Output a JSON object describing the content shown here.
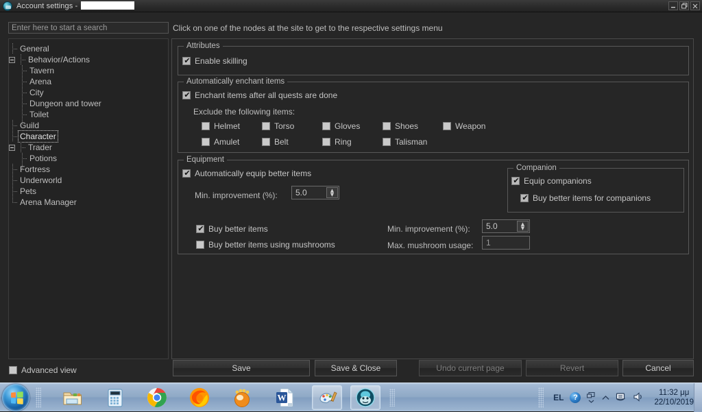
{
  "window": {
    "title": "Account settings -",
    "icon": "app-avatar-icon",
    "redacted_account": true,
    "controls": {
      "minimize": "minimize-icon",
      "restore": "restore-icon",
      "close": "close-icon"
    }
  },
  "search": {
    "placeholder": "Enter here to start a search",
    "value": ""
  },
  "hint": "Click on one of the nodes at the site to get to the respective settings menu",
  "tree": {
    "items": [
      {
        "label": "General",
        "level": 1,
        "expander": false,
        "selected": false
      },
      {
        "label": "Behavior/Actions",
        "level": 1,
        "expander": true,
        "selected": false
      },
      {
        "label": "Tavern",
        "level": 2,
        "expander": false,
        "selected": false
      },
      {
        "label": "Arena",
        "level": 2,
        "expander": false,
        "selected": false
      },
      {
        "label": "City",
        "level": 2,
        "expander": false,
        "selected": false
      },
      {
        "label": "Dungeon and tower",
        "level": 2,
        "expander": false,
        "selected": false
      },
      {
        "label": "Toilet",
        "level": 2,
        "expander": false,
        "selected": false,
        "last": true
      },
      {
        "label": "Guild",
        "level": 1,
        "expander": false,
        "selected": false
      },
      {
        "label": "Character",
        "level": 1,
        "expander": false,
        "selected": true
      },
      {
        "label": "Trader",
        "level": 1,
        "expander": true,
        "selected": false
      },
      {
        "label": "Potions",
        "level": 2,
        "expander": false,
        "selected": false,
        "last": true
      },
      {
        "label": "Fortress",
        "level": 1,
        "expander": false,
        "selected": false
      },
      {
        "label": "Underworld",
        "level": 1,
        "expander": false,
        "selected": false
      },
      {
        "label": "Pets",
        "level": 1,
        "expander": false,
        "selected": false
      },
      {
        "label": "Arena Manager",
        "level": 1,
        "expander": false,
        "selected": false,
        "last": true
      }
    ]
  },
  "attributes": {
    "title": "Attributes",
    "enable_skilling": {
      "label": "Enable skilling",
      "checked": true
    }
  },
  "enchant": {
    "title": "Automatically enchant items",
    "enchant_after_quests": {
      "label": "Enchant items after all quests are done",
      "checked": true
    },
    "exclude_label": "Exclude the following items:",
    "exclude_items_row1": [
      {
        "label": "Helmet",
        "checked": false
      },
      {
        "label": "Torso",
        "checked": false
      },
      {
        "label": "Gloves",
        "checked": false
      },
      {
        "label": "Shoes",
        "checked": false
      },
      {
        "label": "Weapon",
        "checked": false
      }
    ],
    "exclude_items_row2": [
      {
        "label": "Amulet",
        "checked": false
      },
      {
        "label": "Belt",
        "checked": false
      },
      {
        "label": "Ring",
        "checked": false
      },
      {
        "label": "Talisman",
        "checked": false
      }
    ]
  },
  "equipment": {
    "title": "Equipment",
    "auto_equip": {
      "label": "Automatically equip better items",
      "checked": true
    },
    "min_improvement_label": "Min. improvement (%):",
    "min_improvement_value": "5.0",
    "buy_better_items": {
      "label": "Buy better items",
      "checked": true
    },
    "buy_with_mushrooms": {
      "label": "Buy better items using mushrooms",
      "checked": false
    },
    "buy_min_improvement_label": "Min. improvement (%):",
    "buy_min_improvement_value": "5.0",
    "max_mushroom_label": "Max. mushroom usage:",
    "max_mushroom_value": "1"
  },
  "companion": {
    "title": "Companion",
    "equip_companions": {
      "label": "Equip companions",
      "checked": true
    },
    "buy_better_for_companions": {
      "label": "Buy better items for companions",
      "checked": true
    }
  },
  "footer": {
    "advanced_view": {
      "label": "Advanced view",
      "checked": false
    },
    "buttons": [
      {
        "label": "Save",
        "disabled": false
      },
      {
        "label": "Save & Close",
        "disabled": false
      },
      {
        "label": "Undo current page",
        "disabled": true
      },
      {
        "label": "Revert",
        "disabled": true
      },
      {
        "label": "Cancel",
        "disabled": false
      }
    ]
  },
  "taskbar": {
    "start": "windows-start-orb",
    "apps": [
      {
        "name": "file-explorer-icon",
        "running": false
      },
      {
        "name": "calculator-icon",
        "running": false
      },
      {
        "name": "google-chrome-icon",
        "running": false
      },
      {
        "name": "mozilla-firefox-icon",
        "running": false
      },
      {
        "name": "orange-app-icon",
        "running": false
      },
      {
        "name": "microsoft-word-icon",
        "running": false
      },
      {
        "name": "paint-icon",
        "running": true
      },
      {
        "name": "game-client-icon",
        "running": true
      }
    ],
    "tray": {
      "language": "EL",
      "help": "help-icon",
      "action_center": "action-center-icon",
      "show_hidden": "show-hidden-icons-icon",
      "network": "network-icon",
      "volume": "volume-icon",
      "time": "11:32 μμ",
      "date": "22/10/2019"
    }
  }
}
